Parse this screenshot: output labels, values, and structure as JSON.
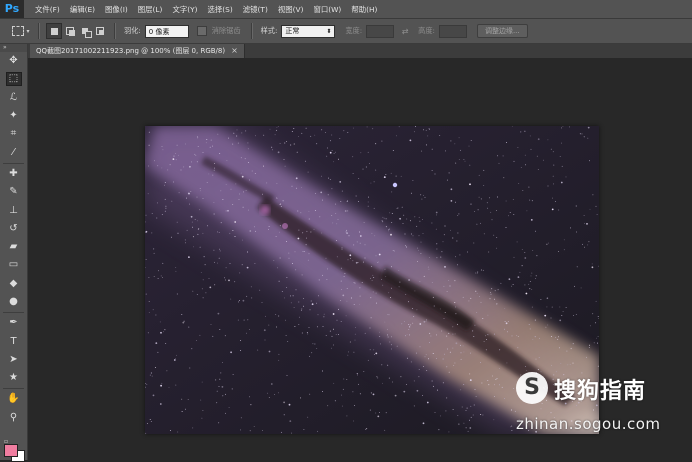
{
  "app": {
    "logo": "Ps",
    "accent_color": "#31a8ff"
  },
  "menu": {
    "items": [
      {
        "label": "文件(F)"
      },
      {
        "label": "编辑(E)"
      },
      {
        "label": "图像(I)"
      },
      {
        "label": "图层(L)"
      },
      {
        "label": "文字(Y)"
      },
      {
        "label": "选择(S)"
      },
      {
        "label": "滤镜(T)"
      },
      {
        "label": "视图(V)"
      },
      {
        "label": "窗口(W)"
      },
      {
        "label": "帮助(H)"
      }
    ]
  },
  "options": {
    "feather_label": "羽化:",
    "feather_value": "0 像素",
    "antialias_label": "消除锯齿",
    "style_label": "样式:",
    "style_value": "正常",
    "width_label": "宽度:",
    "height_label": "高度:",
    "refine_edge_button": "调整边缘..."
  },
  "tools": [
    {
      "name": "move-tool-icon",
      "glyph": "✥"
    },
    {
      "name": "rectangular-marquee-tool-icon",
      "glyph": "⬚",
      "selected": true
    },
    {
      "name": "lasso-tool-icon",
      "glyph": "ℒ"
    },
    {
      "name": "magic-wand-tool-icon",
      "glyph": "✦"
    },
    {
      "name": "crop-tool-icon",
      "glyph": "⌗"
    },
    {
      "name": "eyedropper-tool-icon",
      "glyph": "⁄"
    },
    {
      "name": "healing-brush-tool-icon",
      "glyph": "✚"
    },
    {
      "name": "brush-tool-icon",
      "glyph": "✎"
    },
    {
      "name": "clone-stamp-tool-icon",
      "glyph": "⊥"
    },
    {
      "name": "history-brush-tool-icon",
      "glyph": "↺"
    },
    {
      "name": "eraser-tool-icon",
      "glyph": "▰"
    },
    {
      "name": "gradient-tool-icon",
      "glyph": "▭"
    },
    {
      "name": "blur-tool-icon",
      "glyph": "◆"
    },
    {
      "name": "dodge-tool-icon",
      "glyph": "●"
    },
    {
      "name": "pen-tool-icon",
      "glyph": "✒"
    },
    {
      "name": "type-tool-icon",
      "glyph": "T"
    },
    {
      "name": "path-selection-tool-icon",
      "glyph": "➤"
    },
    {
      "name": "shape-tool-icon",
      "glyph": "★"
    },
    {
      "name": "hand-tool-icon",
      "glyph": "✋"
    },
    {
      "name": "zoom-tool-icon",
      "glyph": "⚲"
    }
  ],
  "colors": {
    "foreground": "#f07da0",
    "background": "#ffffff"
  },
  "document": {
    "tab_title": "QQ截图20171002211923.png @ 100% (图层 0, RGB/8)",
    "close_glyph": "×"
  },
  "watermark": {
    "title": "搜狗指南",
    "url": "zhinan.sogou.com"
  }
}
